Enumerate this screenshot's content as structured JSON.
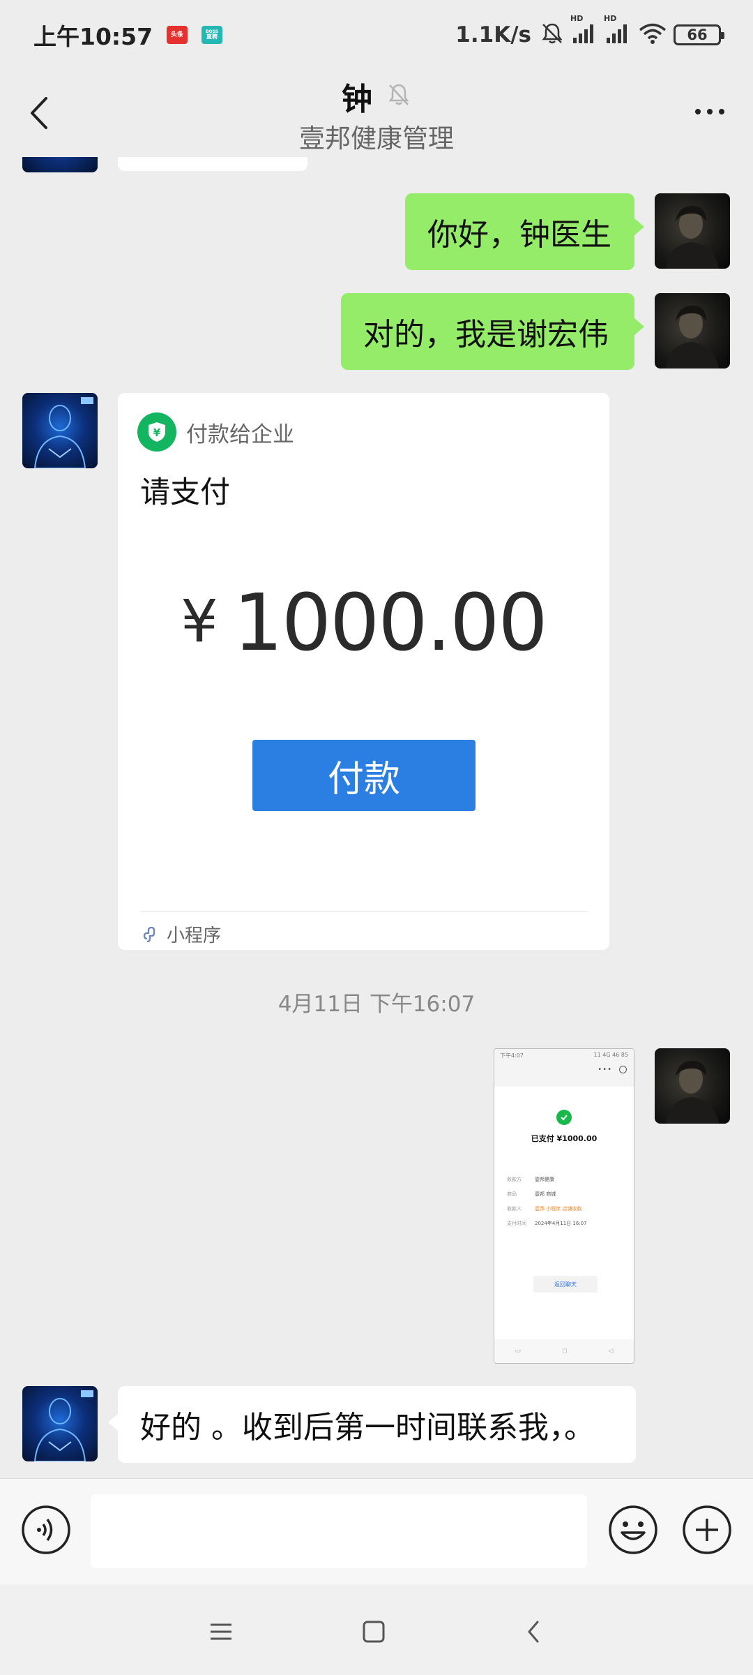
{
  "status_bar": {
    "time": "上午10:57",
    "badge_1": "头条",
    "badge_2_line1": "BOSS",
    "badge_2_line2": "直聘",
    "net_speed": "1.1K/s",
    "hd_1": "HD",
    "hd_2": "HD",
    "battery": "66"
  },
  "header": {
    "title": "钟",
    "subtitle": "壹邦健康管理",
    "mute_icon": "bell-off-icon",
    "more_icon": "more-dots-icon"
  },
  "messages": {
    "msg_1": "你好，钟医生",
    "msg_2": "对的，我是谢宏伟",
    "payment_card": {
      "header_label": "付款给企业",
      "title": "请支付",
      "currency": "¥",
      "amount": "1000.00",
      "button_label": "付款",
      "footer_label": "小程序"
    },
    "timestamp": "4月11日 下午16:07",
    "screenshot": {
      "status_left": "下午4:07",
      "status_right": "11 4G 46 85",
      "ctrl_dots": "•••",
      "paid_text": "已支付 ¥1000.00",
      "rows": [
        {
          "k": "收款方",
          "v": "壹邦健康"
        },
        {
          "k": "商品",
          "v": "壹邦 商城"
        },
        {
          "k": "收款人",
          "v": "壹邦 小程序 店铺收款"
        },
        {
          "k": "支付时间",
          "v": "2024年4月11日 16:07"
        }
      ],
      "back_button": "返回聊天",
      "nav": [
        "▭",
        "◻",
        "◁"
      ]
    },
    "msg_3": "好的 。收到后第一时间联系我，。"
  },
  "input_bar": {
    "placeholder": "",
    "value": ""
  },
  "colors": {
    "bubble_out": "#95ec69",
    "bubble_in": "#ffffff",
    "pay_button": "#2b7fe3",
    "pay_icon": "#13b561",
    "background": "#ededed"
  }
}
